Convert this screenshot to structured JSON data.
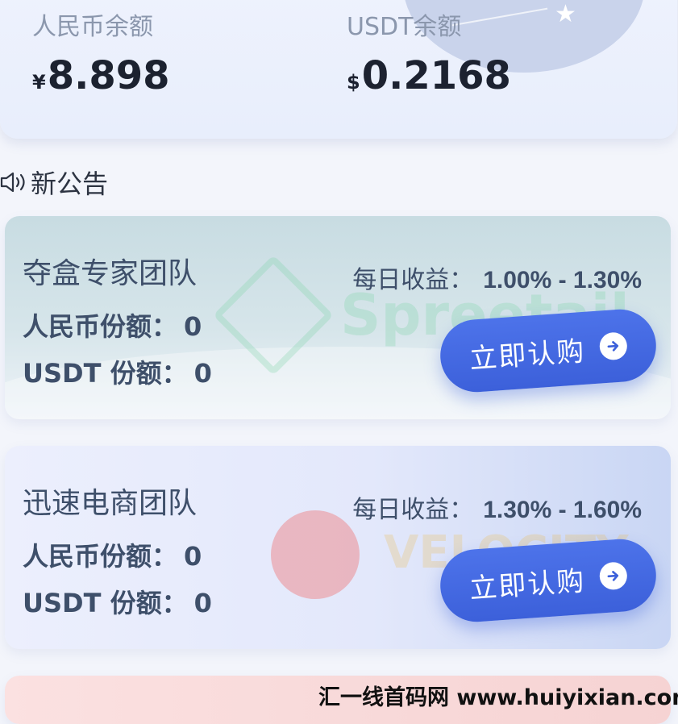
{
  "balances": {
    "cny": {
      "label": "人民币余额",
      "currency_symbol": "¥",
      "amount": "8.898"
    },
    "usdt": {
      "label": "USDT余额",
      "currency_symbol": "$",
      "amount": "0.2168"
    }
  },
  "announcement": {
    "text": "新公告",
    "icon": "speaker-icon"
  },
  "products": [
    {
      "title": "夺盒专家团队",
      "yield_label": "每日收益：",
      "yield_range": "1.00% - 1.30%",
      "cny_share_label": "人民币份额：",
      "cny_share_value": "0",
      "usdt_share_label": "USDT 份额：",
      "usdt_share_value": "0",
      "button_label": "立即认购",
      "logo_word": "Spreetail"
    },
    {
      "title": "迅速电商团队",
      "yield_label": "每日收益：",
      "yield_range": "1.30% - 1.60%",
      "cny_share_label": "人民币份额：",
      "cny_share_value": "0",
      "usdt_share_label": "USDT 份额：",
      "usdt_share_value": "0",
      "button_label": "立即认购",
      "logo_word": "VELOCITY"
    }
  ],
  "watermark": {
    "text": "汇一线首码网 www.huiyixian.com"
  },
  "colors": {
    "button": "#3c60da",
    "card1": "#c8dce2",
    "card2": "#e3e8fb",
    "card3": "#f6d3d3"
  }
}
